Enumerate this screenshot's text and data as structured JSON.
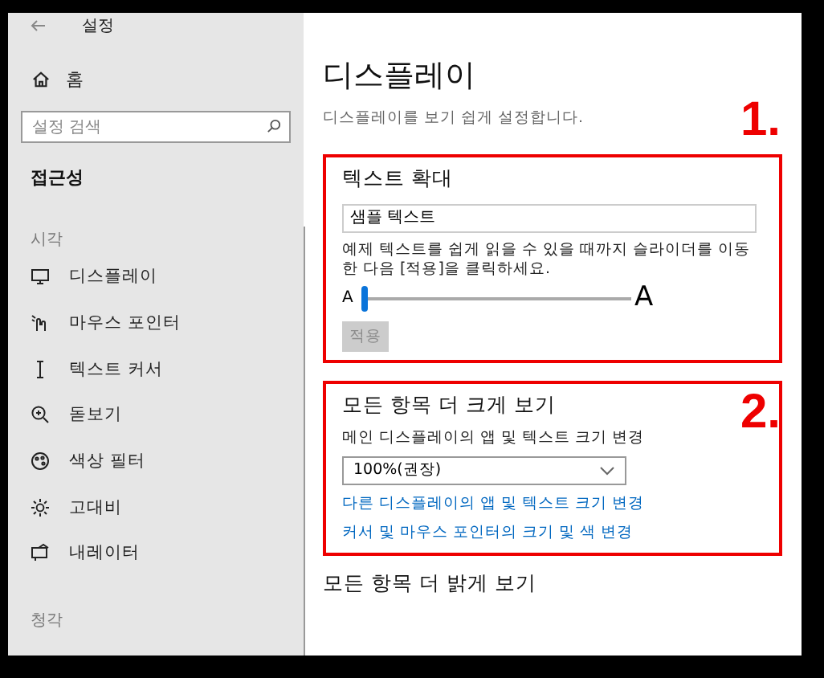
{
  "window": {
    "title": "설정"
  },
  "sidebar": {
    "home": "홈",
    "search": {
      "placeholder": "설정 검색"
    },
    "heading": "접근성",
    "section": "시각",
    "items": [
      {
        "kind": "display",
        "label": "디스플레이"
      },
      {
        "kind": "pointer",
        "label": "마우스 포인터"
      },
      {
        "kind": "cursor",
        "label": "텍스트 커서"
      },
      {
        "kind": "magnifier",
        "label": "돋보기"
      },
      {
        "kind": "palette",
        "label": "색상 필터"
      },
      {
        "kind": "contrast",
        "label": "고대비"
      },
      {
        "kind": "narrator",
        "label": "내레이터"
      }
    ],
    "section_2": "청각"
  },
  "page": {
    "title": "디스플레이",
    "subtitle": "디스플레이를 보기 쉽게 설정합니다.",
    "text_size": {
      "marker": "1.",
      "title": "텍스트 확대",
      "sample": "샘플 텍스트",
      "description": "예제 텍스트를 쉽게 읽을 수 있을 때까지 슬라이더를 이동한 다음 [적용]을 클릭하세요.",
      "small_label": "A",
      "large_label": "A",
      "level": 0.0,
      "apply": {
        "label": "적용",
        "disabled": true
      }
    },
    "bigger": {
      "marker": "2.",
      "title": "모든 항목 더 크게 보기",
      "label": "메인 디스플레이의 앱 및 텍스트 크기 변경",
      "dropdown": "100%(권장)",
      "links": [
        "다른 디스플레이의 앱 및 텍스트 크기 변경",
        "커서 및 마우스 포인터의 크기 및 색 변경"
      ]
    },
    "brighter": {
      "title": "모든 항목 더 밝게 보기"
    }
  }
}
